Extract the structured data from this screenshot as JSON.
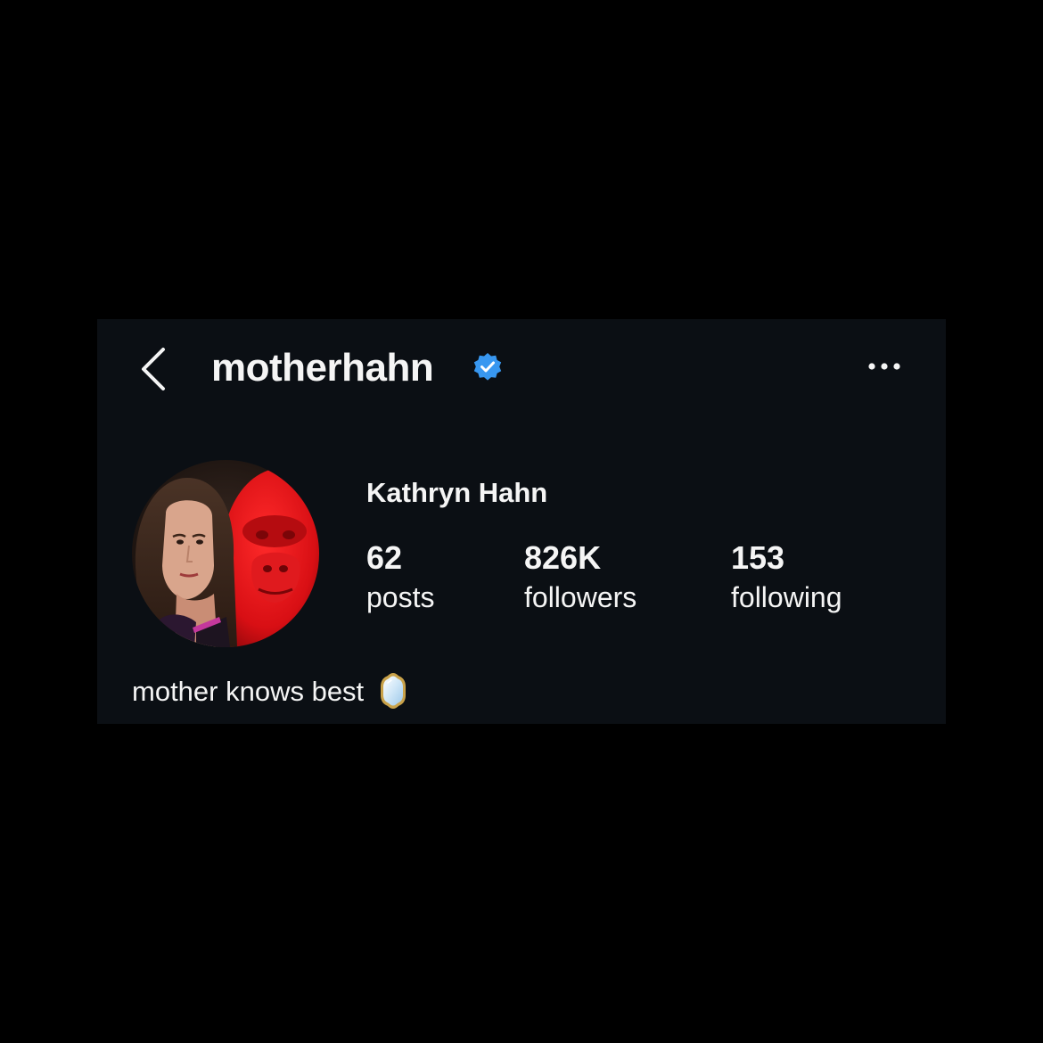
{
  "header": {
    "back_icon": "chevron-left-icon",
    "username": "motherhahn",
    "verified_icon": "verified-badge-icon",
    "more_icon": "more-horizontal-icon"
  },
  "profile": {
    "avatar": "profile-photo",
    "display_name": "Kathryn Hahn",
    "stats": {
      "posts": {
        "value": "62",
        "label": "posts"
      },
      "followers": {
        "value": "826K",
        "label": "followers"
      },
      "following": {
        "value": "153",
        "label": "following"
      }
    },
    "bio": "mother knows best",
    "bio_emoji_icon": "mirror-emoji-icon"
  },
  "colors": {
    "background": "#000000",
    "panel": "#0b0f14",
    "text": "#f5f5f5",
    "verified": "#3897f0"
  }
}
